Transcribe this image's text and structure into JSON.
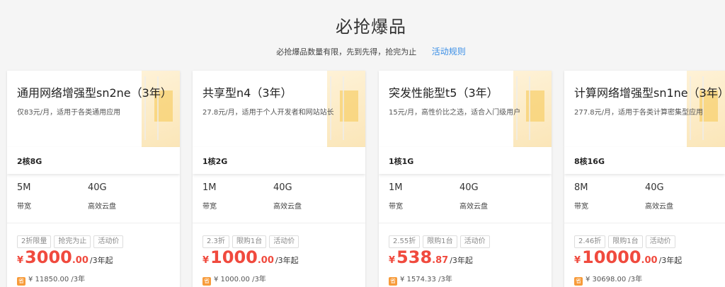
{
  "header": {
    "title": "必抢爆品",
    "subtitle": "必抢爆品数量有限，先到先得，抢完为止",
    "rules_link": "活动规则"
  },
  "colors": {
    "accent": "#f04a3e",
    "link": "#3a8ee6",
    "badge": "#f79b3a"
  },
  "cards": [
    {
      "name": "通用网络增强型sn2ne（3年）",
      "desc": "仅83元/月，适用于各类通用应用",
      "spec": "2核8G",
      "bandwidth_value": "5M",
      "bandwidth_label": "带宽",
      "disk_value": "40G",
      "disk_label": "高效云盘",
      "tags": [
        "2折限量",
        "抢完为止",
        "活动价"
      ],
      "price_yen": "¥",
      "price_int": "3000",
      "price_dec": ".00",
      "price_unit": "/3年起",
      "badge": "省",
      "orig_price": "¥ 11850.00 /3年"
    },
    {
      "name": "共享型n4（3年）",
      "desc": "27.8元/月，适用于个人开发者和网站站长",
      "spec": "1核2G",
      "bandwidth_value": "1M",
      "bandwidth_label": "带宽",
      "disk_value": "40G",
      "disk_label": "高效云盘",
      "tags": [
        "2.3折",
        "限购1台",
        "活动价"
      ],
      "price_yen": "¥",
      "price_int": "1000",
      "price_dec": ".00",
      "price_unit": "/3年起",
      "badge": "省",
      "orig_price": "¥ 1000.00 /3年"
    },
    {
      "name": "突发性能型t5（3年）",
      "desc": "15元/月，高性价比之选，适合入门级用户",
      "spec": "1核1G",
      "bandwidth_value": "1M",
      "bandwidth_label": "带宽",
      "disk_value": "40G",
      "disk_label": "高效云盘",
      "tags": [
        "2.55折",
        "限购1台",
        "活动价"
      ],
      "price_yen": "¥",
      "price_int": "538",
      "price_dec": ".87",
      "price_unit": "/3年起",
      "badge": "省",
      "orig_price": "¥ 1574.33 /3年"
    },
    {
      "name": "计算网络增强型sn1ne（3年）",
      "desc": "277.8元/月，适用于各类计算密集型应用",
      "spec": "8核16G",
      "bandwidth_value": "8M",
      "bandwidth_label": "带宽",
      "disk_value": "40G",
      "disk_label": "高效云盘",
      "tags": [
        "2.46折",
        "限购1台",
        "活动价"
      ],
      "price_yen": "¥",
      "price_int": "10000",
      "price_dec": ".00",
      "price_unit": "/3年起",
      "badge": "省",
      "orig_price": "¥ 30698.00 /3年"
    }
  ]
}
